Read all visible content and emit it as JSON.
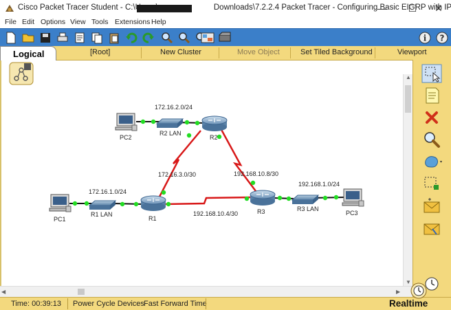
{
  "window": {
    "title_prefix": "Cisco Packet Tracer Student - C:\\Users\\",
    "title_suffix": "Downloads\\7.2.2.4 Packet Tracer - Configuring Basic EIGRP with IP...",
    "controls": {
      "minimize": "—",
      "maximize": "☐",
      "close": "✕"
    }
  },
  "menu": [
    "File",
    "Edit",
    "Options",
    "View",
    "Tools",
    "Extensions",
    "Help"
  ],
  "workspace_bar": {
    "logical_tab": "Logical",
    "items": [
      "[Root]",
      "New Cluster",
      "Move Object",
      "Set Tiled Background",
      "Viewport"
    ]
  },
  "topology": {
    "devices": {
      "pc1": "PC1",
      "pc2": "PC2",
      "pc3": "PC3",
      "r1": "R1",
      "r2": "R2",
      "r3": "R3",
      "s1": "R1 LAN",
      "s2": "R2 LAN",
      "s3": "R3 LAN"
    },
    "networks": {
      "lan1": "172.16.1.0/24",
      "lan2": "172.16.2.0/24",
      "lan3": "192.168.1.0/24",
      "r1_r2": "172.16.3.0/30",
      "r2_r3": "192.168.10.8/30",
      "r1_r3": "192.168.10.4/30"
    }
  },
  "statusbar": {
    "time": "Time: 00:39:13",
    "power_cycle": "Power Cycle Devices",
    "fast_forward": "Fast Forward Time",
    "mode": "Realtime"
  },
  "colors": {
    "toolbar": "#3b7fc9",
    "panel": "#f3d97e",
    "serial_link": "#d81818",
    "ethernet_link": "#111111",
    "link_up": "#22dd22"
  }
}
